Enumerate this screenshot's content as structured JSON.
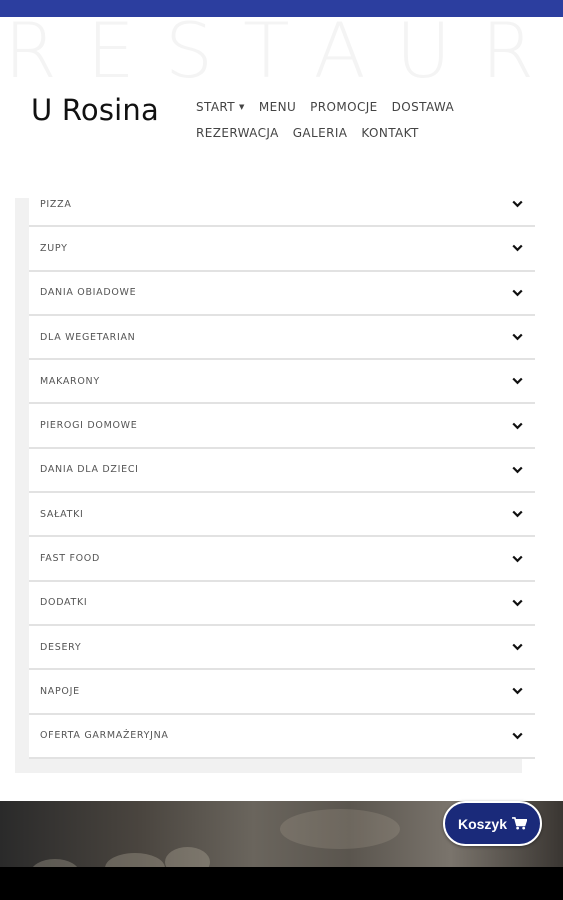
{
  "background_word": "RESTAURA",
  "brand": {
    "name": "U Rosina"
  },
  "nav": {
    "row1": [
      "START",
      "MENU",
      "PROMOCJE",
      "DOSTAWA"
    ],
    "row2": [
      "REZERWACJA",
      "GALERIA",
      "KONTAKT"
    ]
  },
  "menu_categories": [
    "PIZZA",
    "ZUPY",
    "DANIA OBIADOWE",
    "DLA WEGETARIAN",
    "MAKARONY",
    "PIEROGI DOMOWE",
    "DANIA DLA DZIECI",
    "SAŁATKI",
    "FAST FOOD",
    "DODATKI",
    "DESERY",
    "NAPOJE",
    "OFERTA GARMAŻERYJNA"
  ],
  "cart": {
    "label": "Koszyk",
    "icon": "shopping-cart-icon"
  },
  "colors": {
    "accent": "#2c3e9f",
    "cart_bg": "#1a2a7a"
  }
}
